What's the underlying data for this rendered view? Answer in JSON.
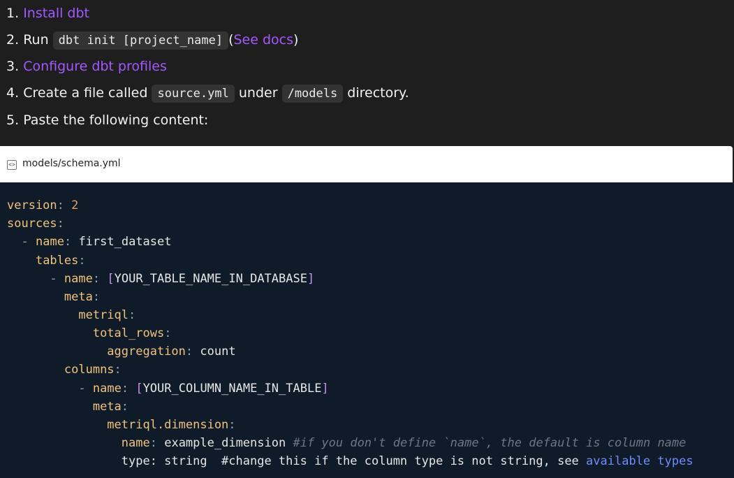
{
  "steps": [
    {
      "num": "1.",
      "link": "Install dbt"
    },
    {
      "num": "2.",
      "text_before": "Run",
      "code": "dbt init [project_name]",
      "paren_open": "(",
      "link": "See docs",
      "paren_close": ")"
    },
    {
      "num": "3.",
      "link": "Configure dbt profiles"
    },
    {
      "num": "4.",
      "text_before": "Create a file called",
      "code1": "source.yml",
      "text_mid": "under",
      "code2": "/models",
      "text_after": "directory."
    },
    {
      "num": "5.",
      "text": "Paste the following content:"
    }
  ],
  "file": {
    "icon": "code-file-icon",
    "icon_glyph": "<>",
    "name": "models/schema.yml"
  },
  "code": {
    "l1": {
      "key": "version",
      "colon": ":",
      "value": "2"
    },
    "l2": {
      "key": "sources",
      "colon": ":"
    },
    "l3": {
      "dash": "-",
      "key": "name",
      "colon": ":",
      "value": "first_dataset"
    },
    "l4": {
      "key": "tables",
      "colon": ":"
    },
    "l5": {
      "dash": "-",
      "key": "name",
      "colon": ":",
      "bo": "[",
      "value": "YOUR_TABLE_NAME_IN_DATABASE",
      "bc": "]"
    },
    "l6": {
      "key": "meta",
      "colon": ":"
    },
    "l7": {
      "key": "metriql",
      "colon": ":"
    },
    "l8": {
      "key": "total_rows",
      "colon": ":"
    },
    "l9": {
      "key": "aggregation",
      "colon": ":",
      "value": "count"
    },
    "l10": {
      "key": "columns",
      "colon": ":"
    },
    "l11": {
      "dash": "-",
      "key": "name",
      "colon": ":",
      "bo": "[",
      "value": "YOUR_COLUMN_NAME_IN_TABLE",
      "bc": "]"
    },
    "l12": {
      "key": "meta",
      "colon": ":"
    },
    "l13": {
      "key": "metriql.dimension",
      "colon": ":"
    },
    "l14": {
      "key": "name",
      "colon": ":",
      "value": "example_dimension",
      "comment": "#if you don't define `name`, the default is column name"
    },
    "l15": {
      "text": "type: string  #change this if the column type is not string, see",
      "link": "available types"
    }
  },
  "colors": {
    "link": "#a259ff",
    "code_background": "#0f1b29",
    "page_background": "#1e1e1e"
  }
}
